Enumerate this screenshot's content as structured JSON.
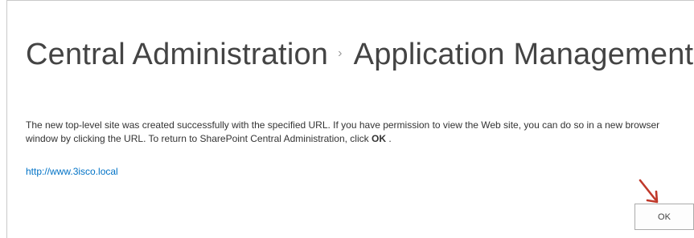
{
  "header": {
    "breadcrumb_root": "Central Administration",
    "separator": "›",
    "breadcrumb_current": "Application Management"
  },
  "message": {
    "text_before_ok": "The new top-level site was created successfully with the specified URL. If you have permission to view the Web site, you can do so in a new browser window by clicking the URL. To return to SharePoint Central Administration, click ",
    "ok_word": "OK",
    "text_after_ok": " ."
  },
  "site_link": {
    "url": "http://www.3isco.local"
  },
  "actions": {
    "ok_label": "OK"
  },
  "colors": {
    "link": "#0072c6",
    "annotation_arrow": "#c0392b"
  }
}
